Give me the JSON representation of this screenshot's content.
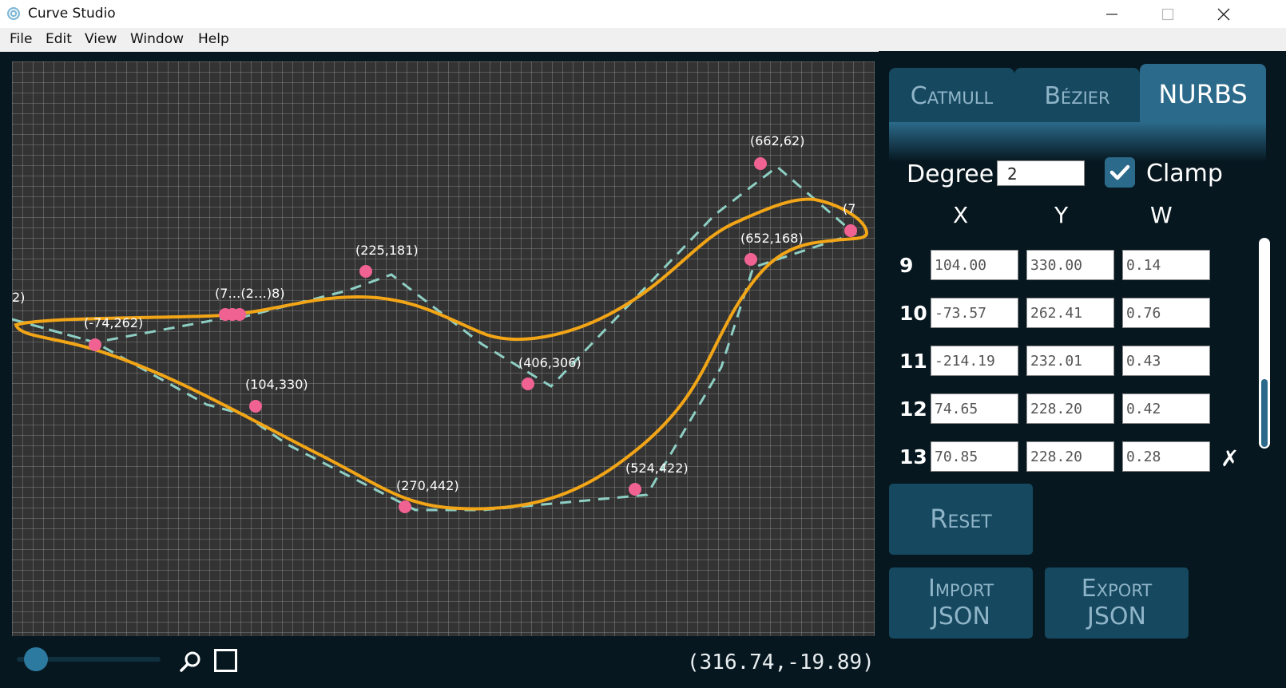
{
  "window": {
    "title": "Curve Studio"
  },
  "menu": [
    "File",
    "Edit",
    "View",
    "Window",
    "Help"
  ],
  "tabs": [
    {
      "label": "Catmull",
      "active": false
    },
    {
      "label": "Bézier",
      "active": false
    },
    {
      "label": "NURBS",
      "active": true
    }
  ],
  "settings": {
    "degree_label": "Degree",
    "degree_value": "2",
    "clamp_label": "Clamp",
    "clamp_checked": true
  },
  "table": {
    "headers": [
      "X",
      "Y",
      "W"
    ],
    "rows": [
      {
        "index": "9",
        "x": "104.00",
        "y": "330.00",
        "w": "0.14"
      },
      {
        "index": "10",
        "x": "-73.57",
        "y": "262.41",
        "w": "0.76"
      },
      {
        "index": "11",
        "x": "-214.19",
        "y": "232.01",
        "w": "0.43"
      },
      {
        "index": "12",
        "x": "74.65",
        "y": "228.20",
        "w": "0.42"
      },
      {
        "index": "13",
        "x": "70.85",
        "y": "228.20",
        "w": "0.28"
      }
    ],
    "delete_glyph": "✗"
  },
  "buttons": {
    "reset": "Reset",
    "import_line1": "Import",
    "import_line2": "JSON",
    "export_line1": "Export",
    "export_line2": "JSON"
  },
  "status": {
    "cursor_coords": "(316.74,-19.89)"
  },
  "canvas": {
    "point_labels": [
      "(-74,262)",
      "(104,330)",
      "(225,181)",
      "(406,306)",
      "(270,442)",
      "(524,422)",
      "(652,168)",
      "(662,62)",
      "(7",
      "2)",
      "(7…(2…)8)"
    ]
  },
  "colors": {
    "curve": "#f2a516",
    "polygon": "#8ecfc4",
    "point": "#f06292",
    "grid_bg": "#333333",
    "panel_bg": "#06171f",
    "tab_active": "#2b6a8a",
    "tab_inactive": "#16485f"
  },
  "icons": [
    "app-icon",
    "minimize-icon",
    "maximize-icon",
    "close-icon",
    "zoom-icon",
    "frame-icon",
    "check-icon",
    "delete-icon"
  ]
}
